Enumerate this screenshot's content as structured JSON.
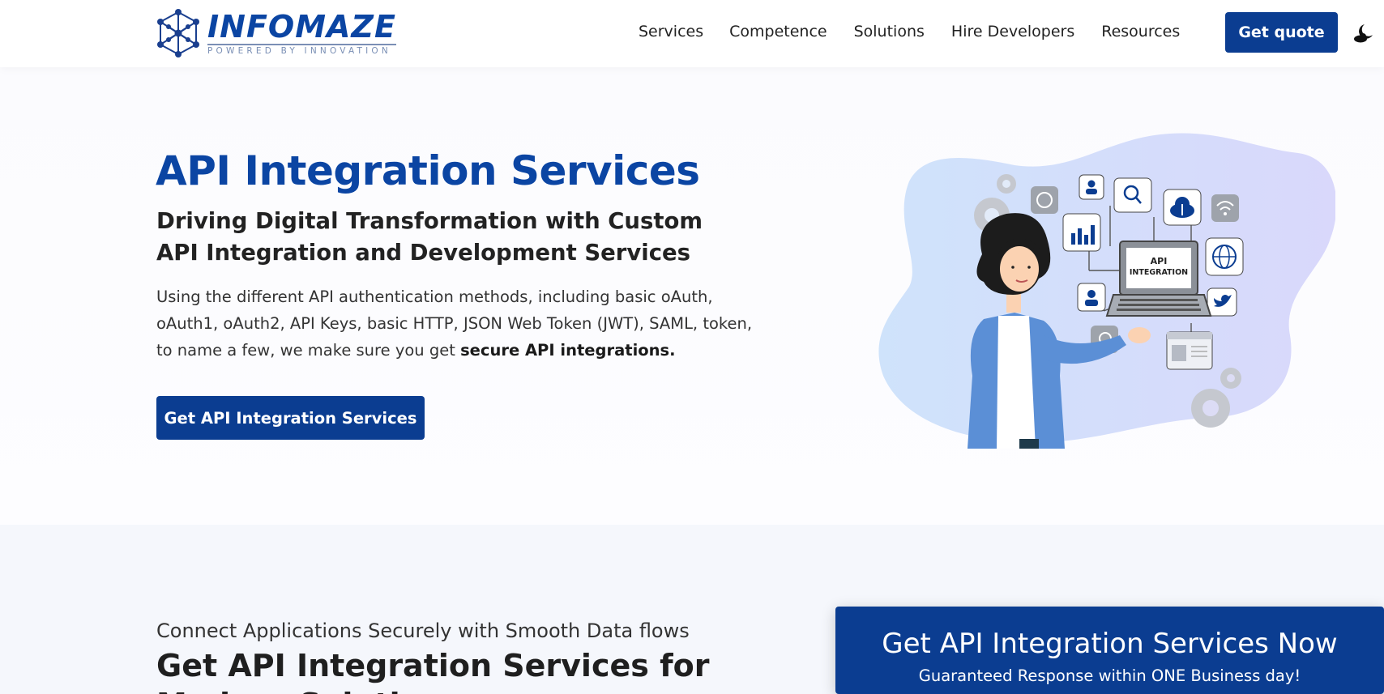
{
  "header": {
    "logo": {
      "name": "INFOMAZE",
      "tagline": "POWERED BY INNOVATION",
      "icon": "network-logo-icon"
    },
    "nav": [
      {
        "label": "Services"
      },
      {
        "label": "Competence"
      },
      {
        "label": "Solutions"
      },
      {
        "label": "Hire Developers"
      },
      {
        "label": "Resources"
      }
    ],
    "quote_label": "Get quote",
    "theme_icon": "moon-cloud-icon"
  },
  "hero": {
    "title": "API Integration Services",
    "subtitle": "Driving Digital Transformation with Custom API Integration and Development Services",
    "description_prefix": "Using the different API authentication methods, including basic oAuth, oAuth1, oAuth2, API Keys, basic HTTP, JSON Web Token (JWT), SAML, token, to name a few, we make sure you get ",
    "description_bold": "secure API integrations.",
    "cta_label": "Get API Integration Services",
    "illustration": {
      "laptop_text": "API INTEGRATION",
      "icons": [
        "whatsapp-icon",
        "user-icon",
        "search-icon",
        "cloud-upload-icon",
        "wifi-icon",
        "chart-icon",
        "globe-icon",
        "twitter-icon",
        "gear-icon"
      ]
    }
  },
  "section2": {
    "kicker": "Connect Applications Securely with Smooth Data flows",
    "title": "Get API Integration Services for Modern Solutions",
    "card": {
      "title": "Get API Integration Services Now",
      "subtitle": "Guaranteed Response within ONE Business day!"
    }
  },
  "colors": {
    "brand": "#0b3d91",
    "heading": "#0b45a3",
    "section_bg": "#f5f7fc"
  }
}
